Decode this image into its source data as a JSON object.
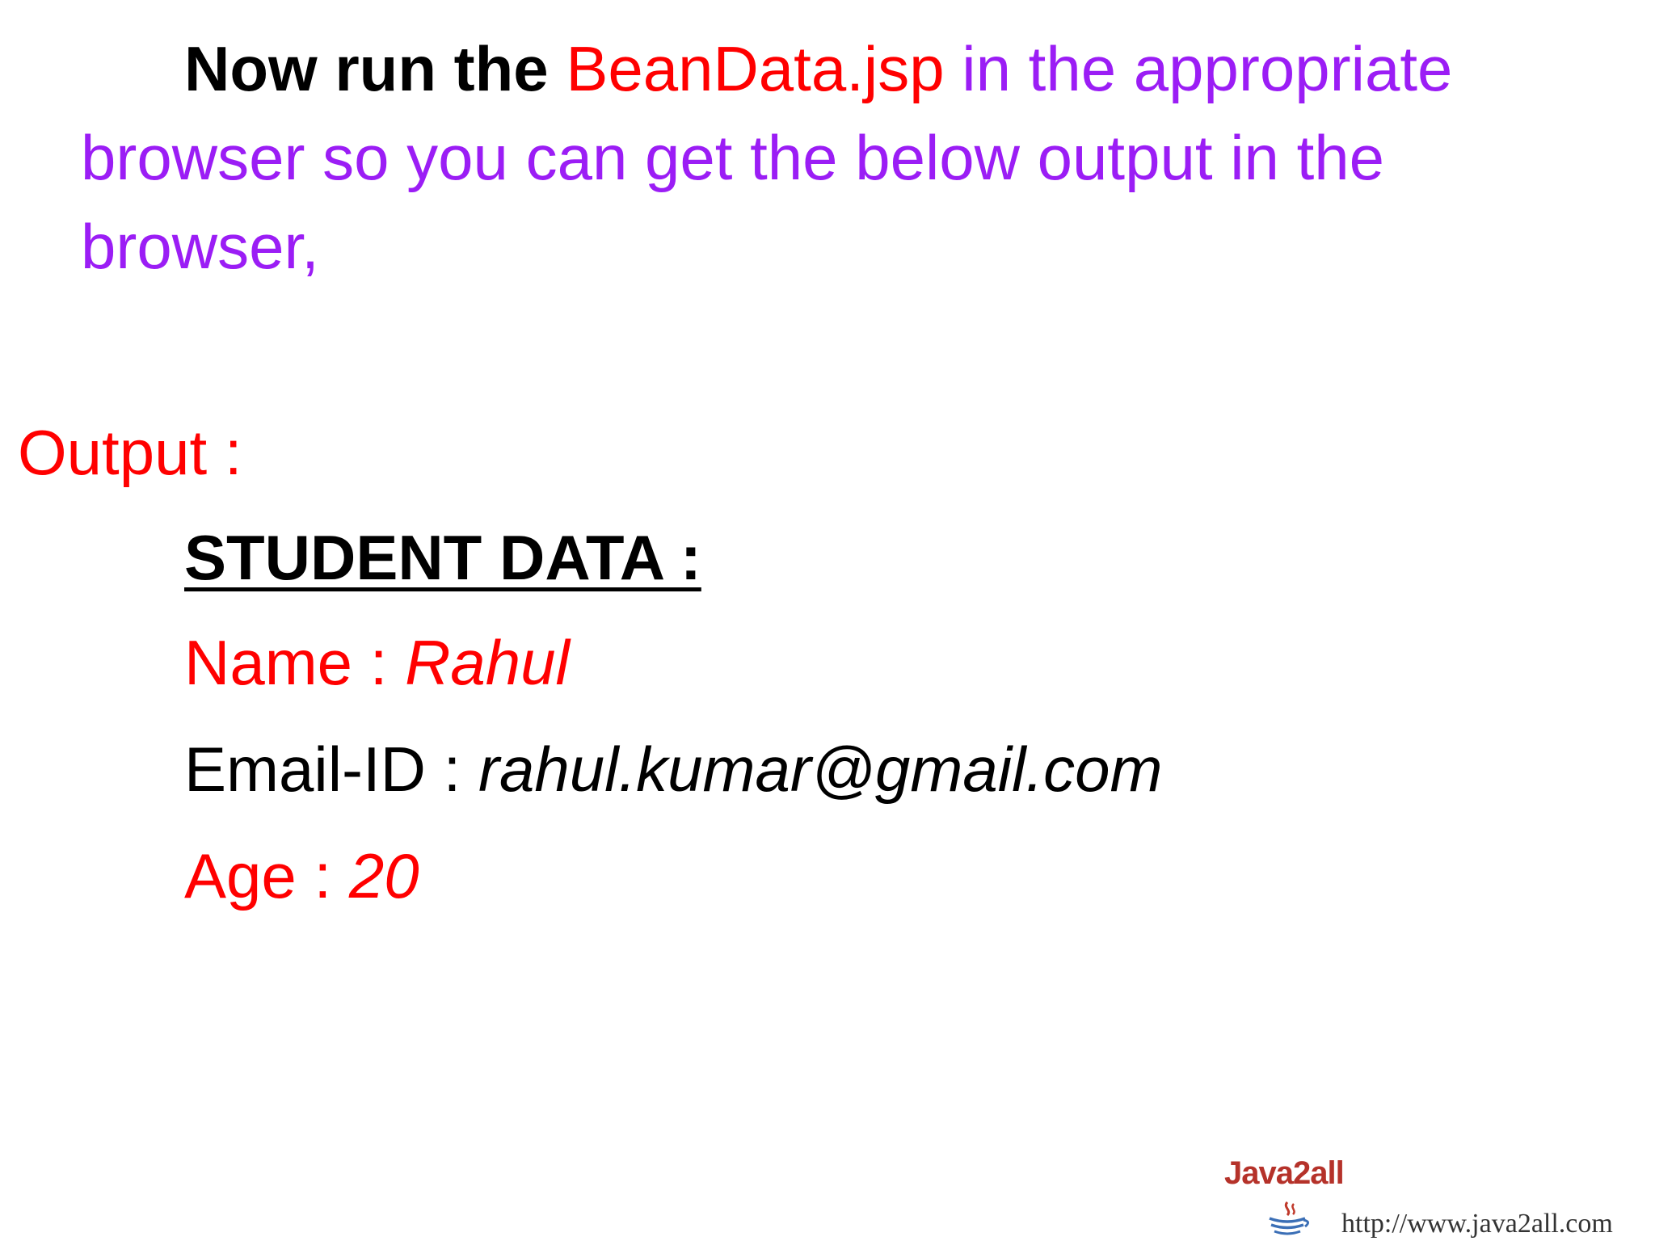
{
  "intro": {
    "lead": "Now run the",
    "file": "BeanData.jsp",
    "rest": "in the appropriate browser so you can get the below output in the browser,"
  },
  "output_label": "Output :",
  "student": {
    "heading": "STUDENT DATA :",
    "name_label": "Name :",
    "name_value": "Rahul",
    "email_label": "Email-ID :",
    "email_value": "rahul.kumar@gmail.com",
    "age_label": "Age :",
    "age_value": "20"
  },
  "footer": {
    "logo_text": "Java2all",
    "url": "http://www.java2all.com"
  },
  "colors": {
    "emphasis_red": "#ff0000",
    "body_purple": "#9b1df5",
    "heading_black": "#000000"
  },
  "icons": {
    "logo": "java-coffee-cup-icon"
  }
}
